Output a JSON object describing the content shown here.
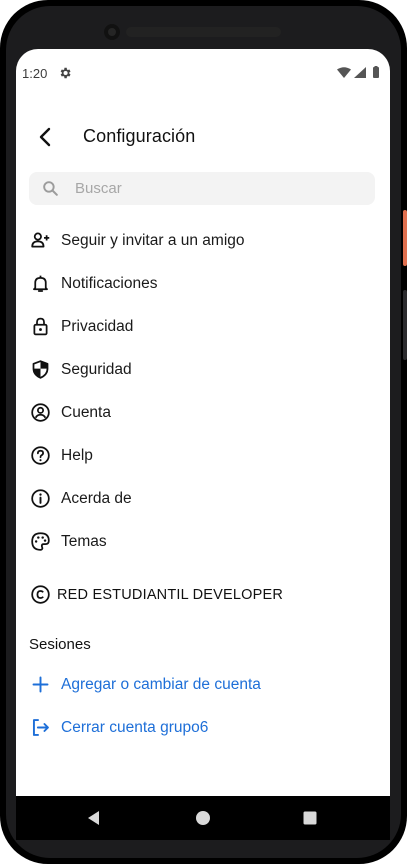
{
  "status_bar": {
    "time": "1:20"
  },
  "header": {
    "title": "Configuración"
  },
  "search": {
    "placeholder": "Buscar"
  },
  "menu_items": [
    {
      "label": "Seguir y invitar a un amigo",
      "icon": "person-add-icon"
    },
    {
      "label": "Notificaciones",
      "icon": "bell-icon"
    },
    {
      "label": "Privacidad",
      "icon": "lock-icon"
    },
    {
      "label": "Seguridad",
      "icon": "shield-icon"
    },
    {
      "label": "Cuenta",
      "icon": "account-circle-icon"
    },
    {
      "label": "Help",
      "icon": "help-circle-icon"
    },
    {
      "label": "Acerda de",
      "icon": "info-icon"
    },
    {
      "label": "Temas",
      "icon": "palette-icon"
    }
  ],
  "brand": {
    "label": "RED ESTUDIANTIL DEVELOPER",
    "icon": "copyright-icon"
  },
  "sessions": {
    "title": "Sesiones",
    "add_account": "Agregar o cambiar de cuenta",
    "logout": "Cerrar cuenta grupo6"
  },
  "colors": {
    "accent": "#1e6fd8",
    "text": "#1a1a1a",
    "search_bg": "#f3f3f3"
  }
}
